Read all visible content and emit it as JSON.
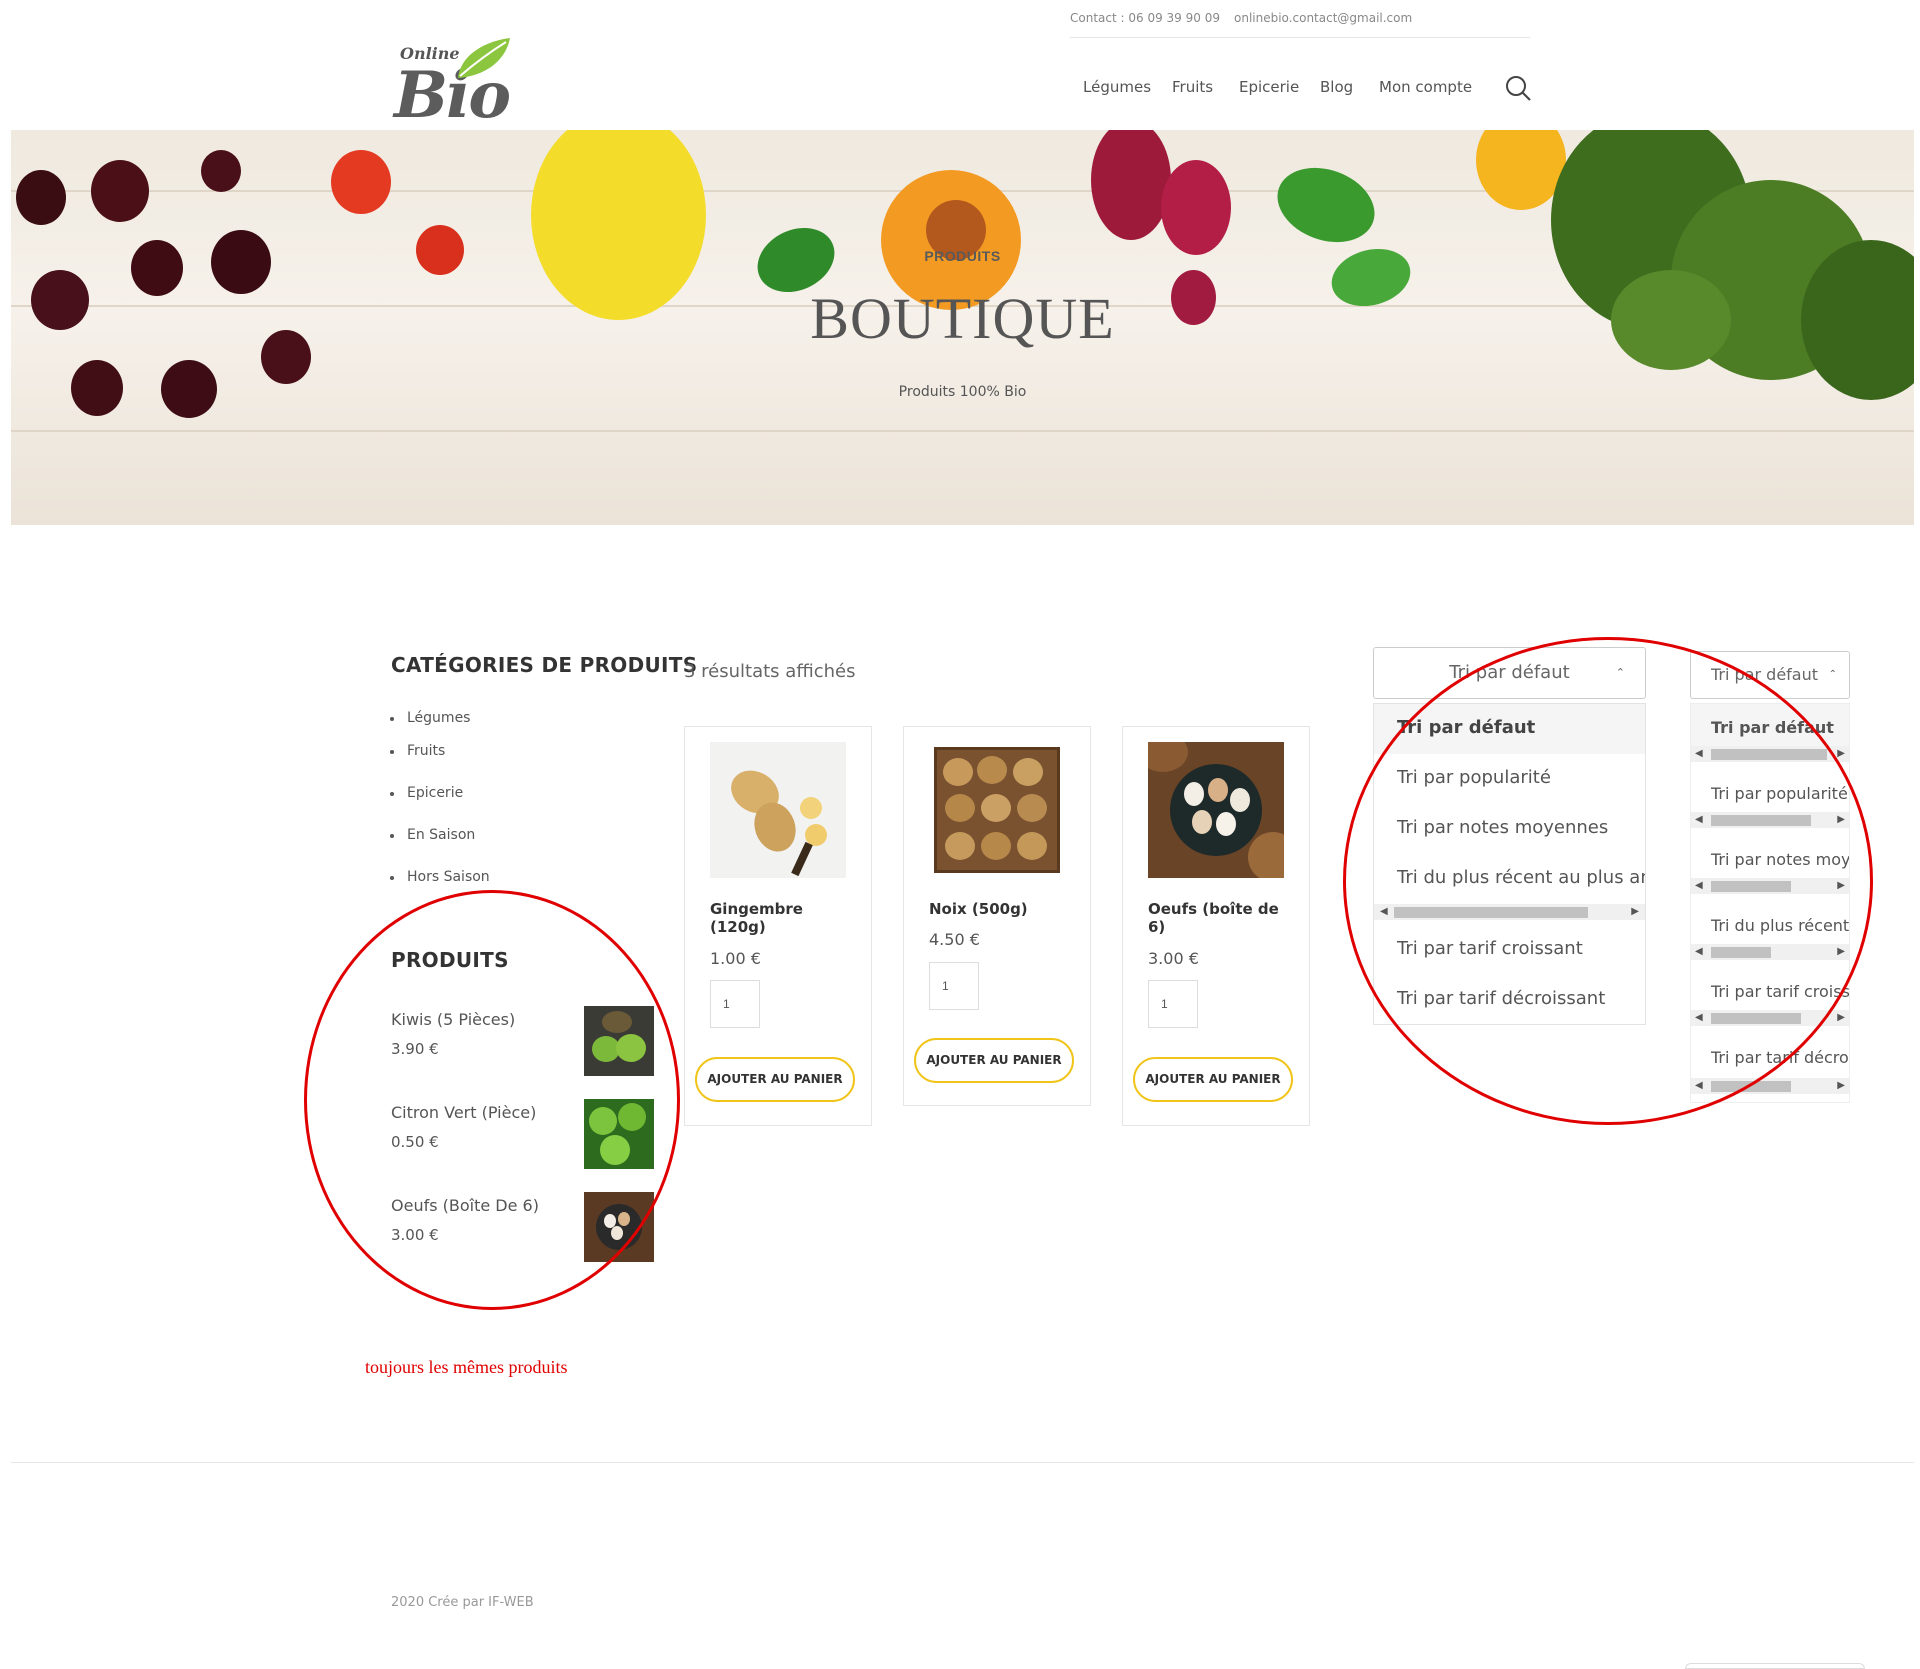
{
  "topbar": {
    "contact": "Contact : 06 09 39 90 09",
    "email": "onlinebio.contact@gmail.com"
  },
  "logo": {
    "small": "Online",
    "big": "Bio"
  },
  "nav": {
    "items": [
      "Légumes",
      "Fruits",
      "Epicerie",
      "Blog",
      "Mon compte"
    ],
    "active": "Epicerie"
  },
  "hero": {
    "supertitle": "PRODUITS",
    "title": "BOUTIQUE",
    "subtitle": "Produits 100% Bio"
  },
  "sidebar": {
    "categories_title": "CATÉGORIES DE PRODUITS",
    "categories": [
      "Légumes",
      "Fruits",
      "Epicerie",
      "En Saison",
      "Hors Saison"
    ],
    "products_title": "PRODUITS",
    "products": [
      {
        "name": "Kiwis (5 Pièces)",
        "price": "3.90 €"
      },
      {
        "name": "Citron Vert (Pièce)",
        "price": "0.50 €"
      },
      {
        "name": "Oeufs (Boîte De 6)",
        "price": "3.00 €"
      }
    ]
  },
  "shop": {
    "results": "3 résultats affichés",
    "products": [
      {
        "name_line1": "Gingembre",
        "name_line2": "(120g)",
        "price": "1.00 €",
        "qty": "1",
        "button": "AJOUTER AU PANIER"
      },
      {
        "name_line1": "Noix (500g)",
        "name_line2": "",
        "price": "4.50 €",
        "qty": "1",
        "button": "AJOUTER AU PANIER"
      },
      {
        "name_line1": "Oeufs (boîte de",
        "name_line2": "6)",
        "price": "3.00 €",
        "qty": "1",
        "button": "AJOUTER AU PANIER"
      }
    ]
  },
  "sort": {
    "selected": "Tri par défaut",
    "options": [
      "Tri par défaut",
      "Tri par popularité",
      "Tri par notes moyennes",
      "Tri du plus récent au plus ancien",
      "Tri par tarif croissant",
      "Tri par tarif décroissant"
    ]
  },
  "annotation": {
    "note": "toujours les mêmes produits"
  },
  "footer": {
    "credit": "2020 Crée par IF-WEB"
  },
  "colors": {
    "accent": "#f0c419",
    "annotation": "#e00000"
  }
}
